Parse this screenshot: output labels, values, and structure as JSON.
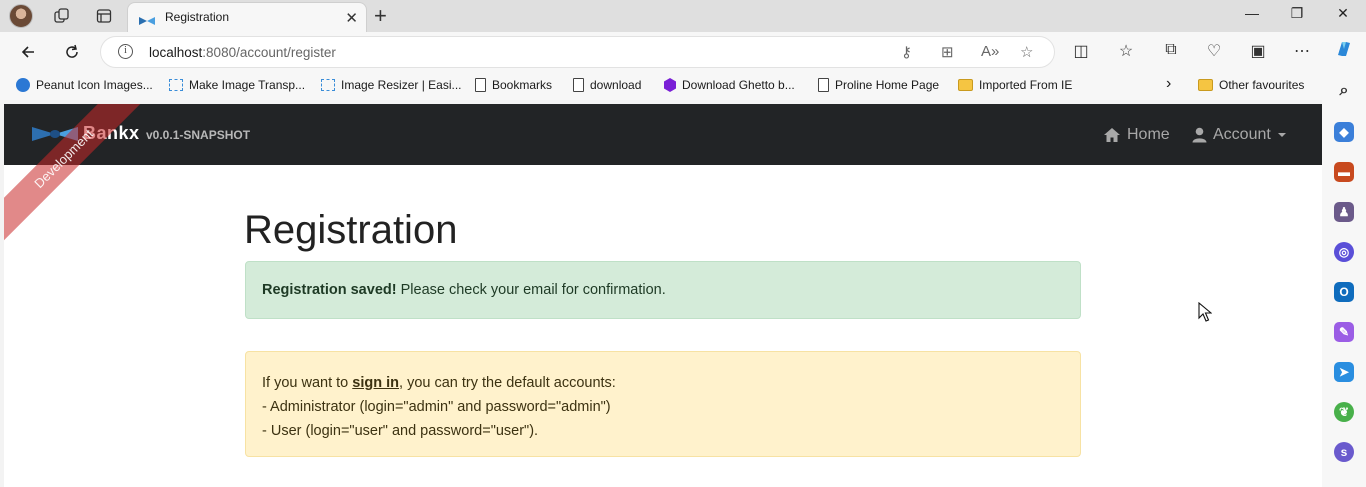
{
  "tab": {
    "title": "Registration",
    "close": "✕"
  },
  "window_controls": {
    "minimize": "—",
    "restore": "❐",
    "close": "✕"
  },
  "newtab": "+",
  "address": {
    "host": "localhost",
    "path": ":8080/account/register",
    "info": "i"
  },
  "favourites": [
    {
      "label": "Peanut Icon Images...",
      "icon": "peanut-icon"
    },
    {
      "label": "Make Image Transp...",
      "icon": "image-icon"
    },
    {
      "label": "Image Resizer | Easi...",
      "icon": "image-icon"
    },
    {
      "label": "Bookmarks",
      "icon": "document-icon"
    },
    {
      "label": "download",
      "icon": "document-icon"
    },
    {
      "label": "Download Ghetto b...",
      "icon": "ghetto-icon"
    },
    {
      "label": "Proline Home Page",
      "icon": "document-icon"
    },
    {
      "label": "Imported From IE",
      "icon": "folder-icon"
    }
  ],
  "favourites_more": "›",
  "other_favourites": "Other favourites",
  "app": {
    "brand": "Bankx",
    "version": "v0.0.1-SNAPSHOT",
    "ribbon": "Development",
    "nav": {
      "home": "Home",
      "account": "Account"
    }
  },
  "page": {
    "heading": "Registration",
    "success_strong": "Registration saved!",
    "success_text": " Please check your email for confirmation.",
    "info_prefix": "If you want to ",
    "info_link": "sign in",
    "info_suffix": ", you can try the default accounts:",
    "info_admin": "- Administrator (login=\"admin\" and password=\"admin\")",
    "info_user": "- User (login=\"user\" and password=\"user\")."
  },
  "colors": {
    "navbar": "#222426",
    "success_bg": "#d4ebd9",
    "warning_bg": "#fff2cc",
    "ribbon": "#c82828"
  }
}
